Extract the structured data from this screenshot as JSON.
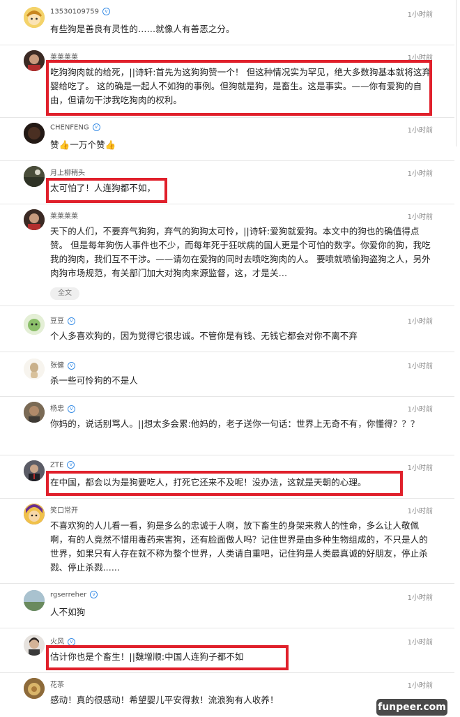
{
  "comments": [
    {
      "user": "13530109759",
      "verified": true,
      "time": "1小时前",
      "text": "有些狗是善良有灵性的……就像人有善恶之分。"
    },
    {
      "user": "莱莱莱莱",
      "verified": false,
      "time": "1小时前",
      "text": "吃狗狗肉就的给死，||诗轩:首先为这狗狗赞一个！ 但这种情况实为罕见，绝大多数狗基本就将这弃婴给吃了。 这的确是一起人不如狗的事例。但狗就是狗，是畜生。这是事实。——你有爱狗的自由，但请勿干涉我吃狗肉的权利。"
    },
    {
      "user": "CHENFENG",
      "verified": true,
      "time": "1小时前",
      "text": "赞👍一万个赞👍"
    },
    {
      "user": "月上柳稍头",
      "verified": false,
      "time": "1小时前",
      "text": "太可怕了！人连狗都不如，"
    },
    {
      "user": "莱莱莱莱",
      "verified": false,
      "time": "1小时前",
      "text": "天下的人们，不要弃气狗狗，弃气的狗狗太可怜，||诗轩:爱狗就爱狗。本文中的狗也的确值得点赞。 但是每年狗伤人事件也不少，而每年死于狂吠病的国人更是个可怕的数字。你爱你的狗，我吃我的狗肉，我们互不干涉。——请勿在爱狗的同时去喷吃狗肉的人。 要喷就喷偷狗盗狗之人，另外肉狗市场规范，有关部门加大对狗肉来源监督，这，才是关…",
      "more": "全文"
    },
    {
      "user": "豆豆",
      "verified": true,
      "time": "1小时前",
      "text": "个人多喜欢狗的，因为觉得它很忠诚。不管你是有钱、无钱它都会对你不离不弃"
    },
    {
      "user": "张健",
      "verified": true,
      "time": "1小时前",
      "text": "杀一些可怜狗的不是人"
    },
    {
      "user": "杨忠",
      "verified": true,
      "time": "1小时前",
      "text": "你妈的，说话别骂人。||想太多会累:他妈的，老子送你一句话：世界上无奇不有，你懂得？？？"
    },
    {
      "user": "ZTE",
      "verified": true,
      "time": "1小时前",
      "text": "在中国，都会以为是狗要吃人，打死它还来不及呢！没办法，这就是天朝的心理。"
    },
    {
      "user": "笑口常开",
      "verified": false,
      "time": "1小时前",
      "text": "不喜欢狗的人儿看一看，狗是多么的忠诚于人啊，放下畜生的身架来救人的性命，多么让人敬佩啊，有的人竟然不惜用毒药来害狗，还有脸面做人吗？记住世界是由多种生物组成的，不只是人的世界，如果只有人存在就不称为整个世界，人类请自重吧，记住狗是人类最真诚的好朋友，停止杀戮、停止杀戮......"
    },
    {
      "user": "rgserreher",
      "verified": true,
      "time": "1小时前",
      "text": "人不如狗"
    },
    {
      "user": "火风",
      "verified": true,
      "time": "1小时前",
      "text": "估计你也是个畜生！||魏增顺:中国人连狗子都不如"
    },
    {
      "user": "花茶",
      "verified": false,
      "time": "1小时前",
      "text": "感动！真的很感动！希望婴儿平安得救！流浪狗有人收养！"
    }
  ],
  "verified_glyph": "v",
  "watermark": "funpeer.com",
  "colors": {
    "highlight": "#e0202b",
    "verified": "#3a8ee6",
    "watermark_bg": "#4a4a4a"
  }
}
